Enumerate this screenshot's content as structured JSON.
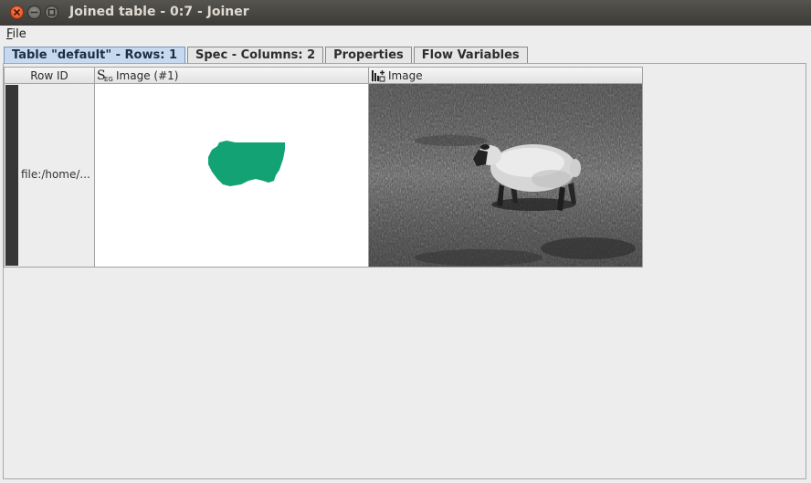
{
  "window": {
    "title": "Joined table - 0:7 - Joiner"
  },
  "menu": {
    "file_pre": "",
    "file_mnemonic": "F",
    "file_rest": "ile"
  },
  "tabs": [
    {
      "label": "Table \"default\" - Rows: 1",
      "active": true
    },
    {
      "label": "Spec - Columns: 2",
      "active": false
    },
    {
      "label": "Properties",
      "active": false
    },
    {
      "label": "Flow Variables",
      "active": false
    }
  ],
  "table": {
    "columns": [
      {
        "label": "Row ID",
        "icon": ""
      },
      {
        "label": "Image (#1)",
        "icon": "segmentation-type-icon"
      },
      {
        "label": "Image",
        "icon": "image-type-icon"
      }
    ],
    "rows": [
      {
        "row_id": "file:/home/...",
        "segment_color": "#13a273",
        "image": "grayscale photo of a sheep walking on grass"
      }
    ]
  },
  "colors": {
    "titlebar": "#3c3b37",
    "active_tab": "#c6d9ef",
    "segment": "#13a273",
    "close_button": "#df4a16"
  }
}
